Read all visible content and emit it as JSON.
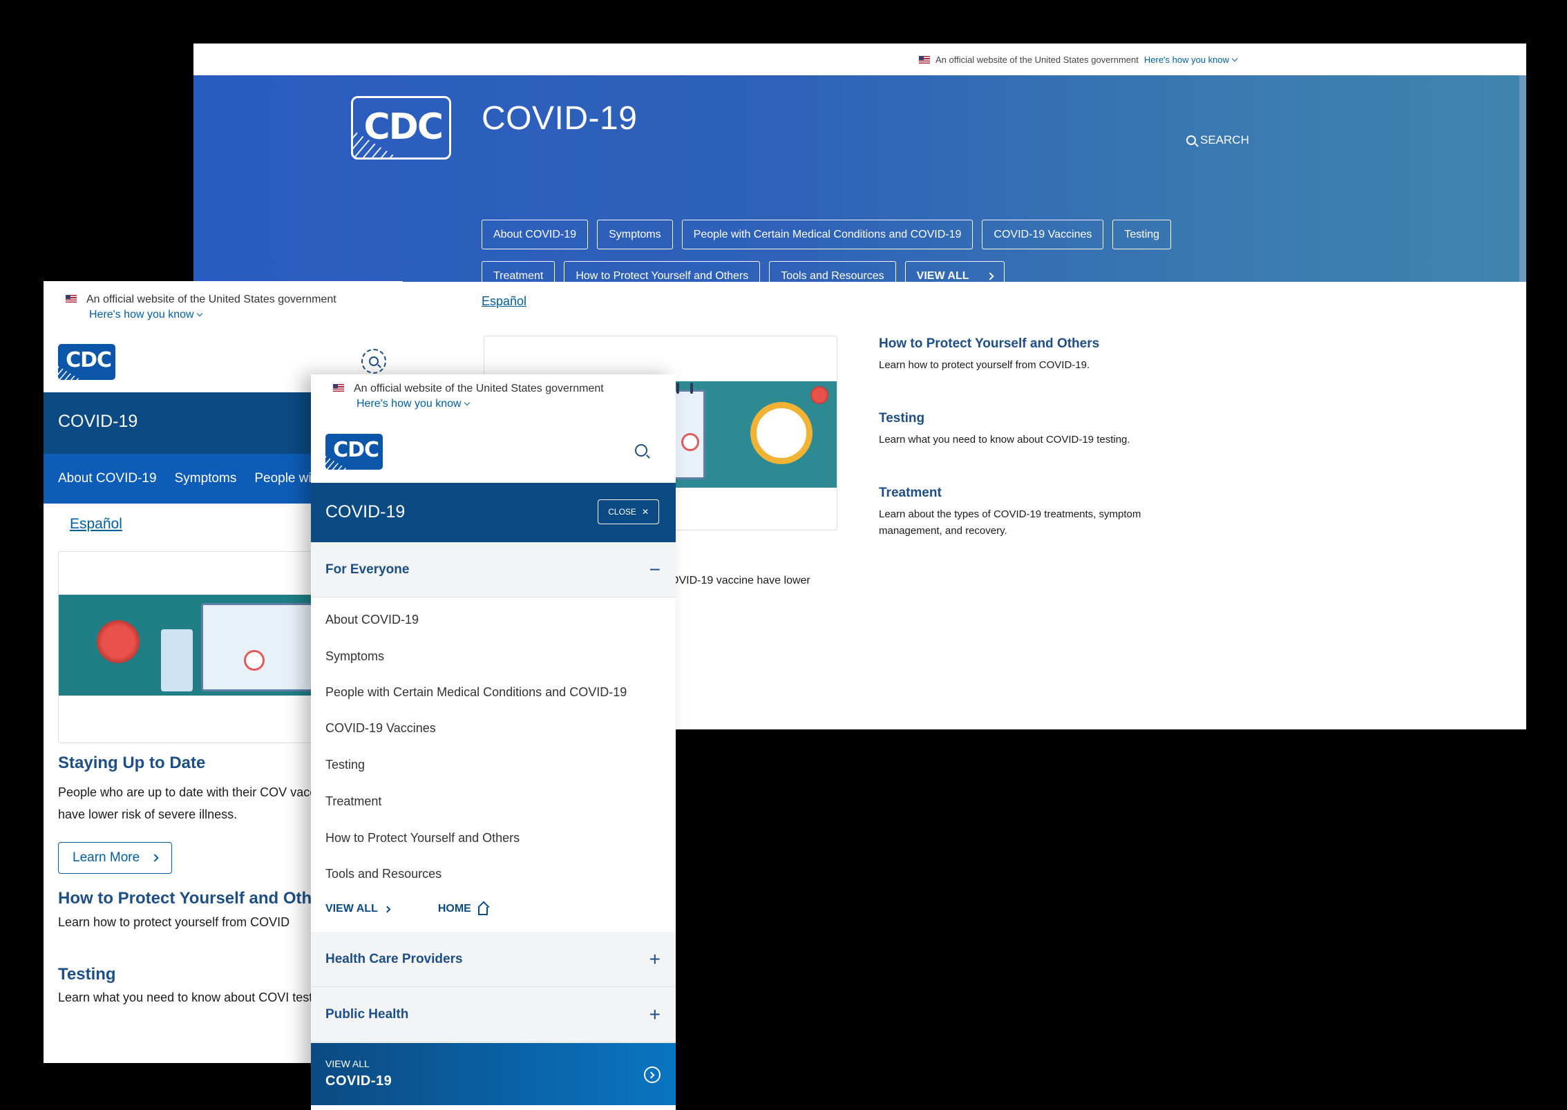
{
  "gov_banner": {
    "official_text": "An official website of the United States government",
    "how_label": "Here's how you know"
  },
  "logo_text": "CDC",
  "site_title": "COVID-19",
  "search_label": "SEARCH",
  "espanol_label": "Español",
  "desktop_nav": [
    "About COVID-19",
    "Symptoms",
    "People with Certain Medical Conditions and COVID-19",
    "COVID-19 Vaccines",
    "Testing",
    "Treatment",
    "How to Protect Yourself and Others",
    "Tools and Resources"
  ],
  "view_all_label": "VIEW ALL",
  "desktop_card_snippet": "OVID-19 vaccine have lower",
  "side_links": [
    {
      "title": "How to Protect Yourself and Others",
      "desc": "Learn how to protect yourself from COVID-19."
    },
    {
      "title": "Testing",
      "desc": "Learn what you need to know about COVID-19 testing."
    },
    {
      "title": "Treatment",
      "desc": "Learn about the types of COVID-19 treatments, symptom management, and recovery."
    }
  ],
  "mobile_subnav": [
    "About COVID-19",
    "Symptoms",
    "People wi"
  ],
  "staying_title": "Staying Up to Date",
  "staying_text": "People who are up to date with their COV vaccine have lower risk of severe illness.",
  "learn_more_label": "Learn More",
  "m1_protect_title": "How to Protect Yourself and Othe",
  "m1_protect_text": "Learn how to protect yourself from COVID",
  "m1_testing_title": "Testing",
  "m1_testing_text": "Learn what you need to know about COVI testing.",
  "menu": {
    "close_label": "CLOSE",
    "section_for_everyone": "For Everyone",
    "items": [
      "About COVID-19",
      "Symptoms",
      "People with Certain Medical Conditions and COVID-19",
      "COVID-19 Vaccines",
      "Testing",
      "Treatment",
      "How to Protect Yourself and Others",
      "Tools and Resources"
    ],
    "view_all": "VIEW ALL",
    "home": "HOME",
    "section_hcp": "Health Care Providers",
    "section_public_health": "Public Health",
    "bottom_small": "VIEW ALL",
    "bottom_big": "COVID-19"
  }
}
